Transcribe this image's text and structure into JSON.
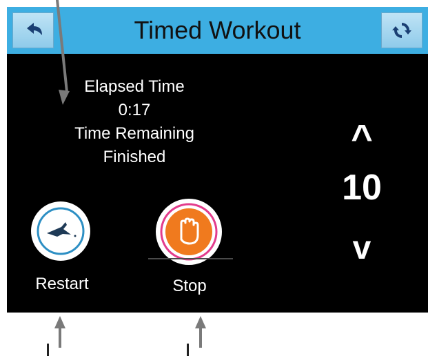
{
  "header": {
    "title": "Timed Workout",
    "back_icon": "back-arrow-icon",
    "refresh_icon": "refresh-icon",
    "accent": "#3daee2"
  },
  "status": {
    "elapsed_label": "Elapsed Time",
    "elapsed_value": "0:17",
    "remaining_label": "Time Remaining",
    "remaining_value": "Finished"
  },
  "counter": {
    "up_label": "^",
    "value": "10",
    "down_label": "v"
  },
  "actions": [
    {
      "label": "Restart",
      "icon": "restart-icon"
    },
    {
      "label": "Stop",
      "icon": "stop-hand-icon",
      "color": "#f07a1e"
    }
  ]
}
